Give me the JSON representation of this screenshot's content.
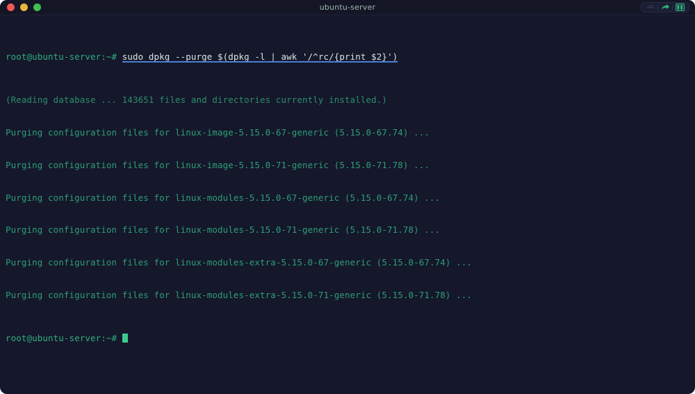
{
  "window": {
    "title": "ubuntu-server",
    "background_color": "#15172b",
    "titlebar_color": "#141626",
    "traffic_lights": [
      {
        "name": "close",
        "color": "#f05a52"
      },
      {
        "name": "minimize",
        "color": "#e9b53f"
      },
      {
        "name": "maximize",
        "color": "#3ec14e"
      }
    ],
    "toolbar": {
      "inspector_label": "iiiil",
      "share_icon": "share-arrow-icon",
      "split_icon": "split-pane-icon"
    }
  },
  "terminal": {
    "prompt": "root@ubuntu-server:~#",
    "command": "sudo dpkg --purge $(dpkg -l | awk '/^rc/{print $2}')",
    "command_underline_color": "#4a7fd4",
    "prompt_color": "#2fae7e",
    "command_color": "#d7e6e0",
    "output_color": "#2d9f76",
    "cursor_color": "#3ec98f",
    "output_lines": [
      "(Reading database ... 143651 files and directories currently installed.)",
      "Purging configuration files for linux-image-5.15.0-67-generic (5.15.0-67.74) ...",
      "Purging configuration files for linux-image-5.15.0-71-generic (5.15.0-71.78) ...",
      "Purging configuration files for linux-modules-5.15.0-67-generic (5.15.0-67.74) ...",
      "Purging configuration files for linux-modules-5.15.0-71-generic (5.15.0-71.78) ...",
      "Purging configuration files for linux-modules-extra-5.15.0-67-generic (5.15.0-67.74) ...",
      "Purging configuration files for linux-modules-extra-5.15.0-71-generic (5.15.0-71.78) ..."
    ],
    "final_prompt": "root@ubuntu-server:~#"
  }
}
